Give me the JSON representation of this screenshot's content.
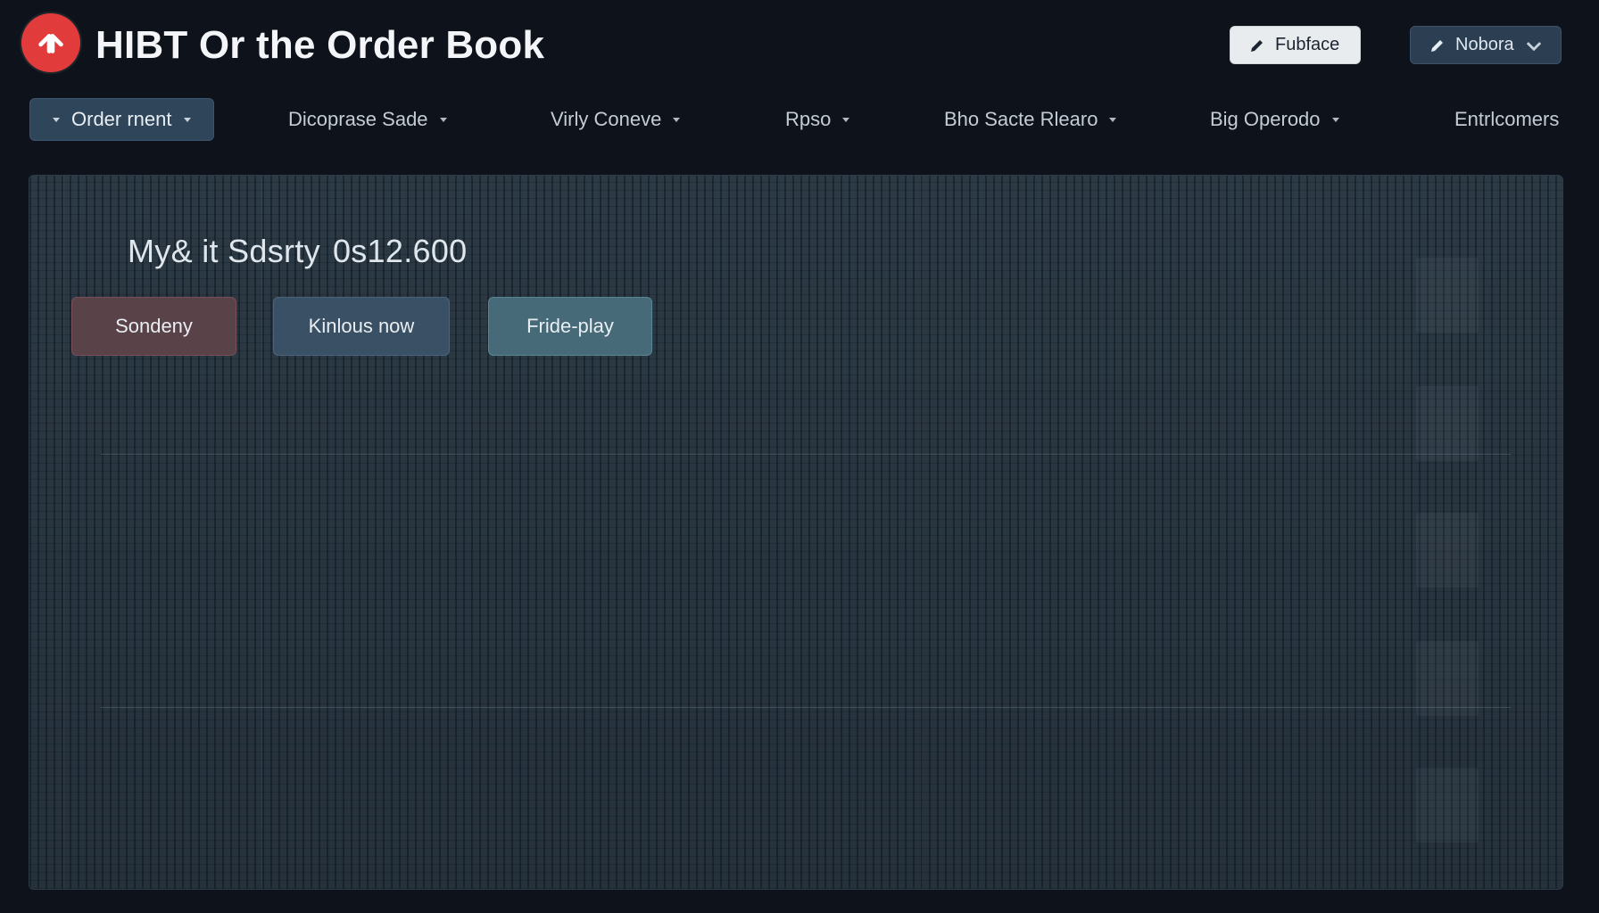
{
  "header": {
    "title": "HIBT Or the Order Book",
    "logo_icon": "arrows-logo-icon",
    "buttons": {
      "primary_label": "Fubface",
      "secondary_label": "Nobora"
    }
  },
  "nav": {
    "items": [
      {
        "label": "Order rnent",
        "active": true
      },
      {
        "label": "Dicoprase Sade"
      },
      {
        "label": "Virly Coneve"
      },
      {
        "label": "Rpso"
      },
      {
        "label": "Bho Sacte Rlearo"
      },
      {
        "label": "Big Operodo"
      },
      {
        "label": "Entrlcomers"
      }
    ]
  },
  "main": {
    "summary_label": "My& it Sdsrty",
    "summary_value": "0s12.600",
    "actions": [
      {
        "label": "Sondeny",
        "color": "#5a4249"
      },
      {
        "label": "Kinlous now",
        "color": "#3a5064"
      },
      {
        "label": "Fride-play",
        "color": "#466a78"
      }
    ]
  },
  "colors": {
    "background": "#0e121a",
    "panel": "#26323d",
    "accent_red": "#e23b3b"
  }
}
